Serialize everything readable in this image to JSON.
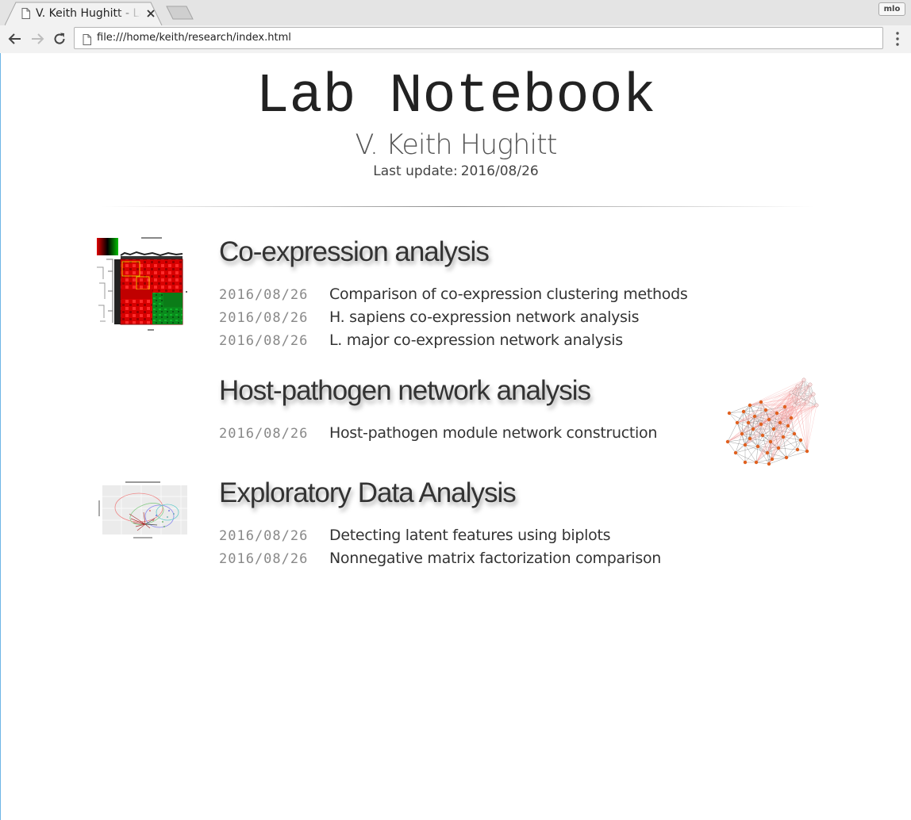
{
  "browser": {
    "tab_title": "V. Keith Hughitt - Lab Notebook",
    "profile_label": "mlo",
    "url": "file:///home/keith/research/index.html"
  },
  "header": {
    "title": "Lab Notebook",
    "author": "V. Keith Hughitt",
    "last_update_label": "Last update:",
    "last_update_date": "2016/08/26"
  },
  "sections": [
    {
      "heading": "Co-expression analysis",
      "thumbnail": "heatmap-thumbnail",
      "entries": [
        {
          "date": "2016/08/26",
          "title": "Comparison of co-expression clustering methods"
        },
        {
          "date": "2016/08/26",
          "title": "H. sapiens co-expression network analysis"
        },
        {
          "date": "2016/08/26",
          "title": "L. major co-expression network analysis"
        }
      ]
    },
    {
      "heading": "Host-pathogen network analysis",
      "thumbnail": "network-graph-thumbnail",
      "entries": [
        {
          "date": "2016/08/26",
          "title": "Host-pathogen module network construction"
        }
      ]
    },
    {
      "heading": "Exploratory Data Analysis",
      "thumbnail": "biplot-thumbnail",
      "entries": [
        {
          "date": "2016/08/26",
          "title": "Detecting latent features using biplots"
        },
        {
          "date": "2016/08/26",
          "title": "Nonnegative matrix factorization comparison"
        }
      ]
    }
  ],
  "colors": {
    "heading": "#333333",
    "date": "#888888",
    "network_node": "#e0601f",
    "heatmap_red": "#ff0000",
    "heatmap_green": "#1a8a1a"
  }
}
